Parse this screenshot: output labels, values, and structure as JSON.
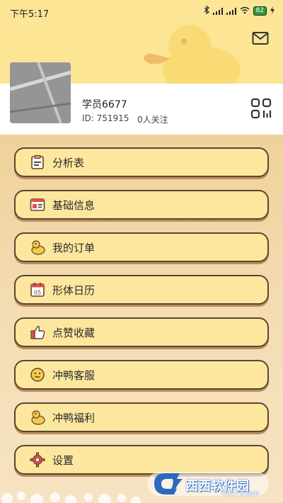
{
  "status_bar": {
    "time": "下午5:17",
    "battery": "82"
  },
  "profile": {
    "username": "学员6677",
    "user_id": "ID: 751915",
    "follow_count": "0人关注"
  },
  "menu": [
    {
      "label": "分析表",
      "icon": "clipboard-icon"
    },
    {
      "label": "基础信息",
      "icon": "id-card-icon"
    },
    {
      "label": "我的订单",
      "icon": "duck-icon"
    },
    {
      "label": "形体日历",
      "icon": "calendar-icon"
    },
    {
      "label": "点赞收藏",
      "icon": "thumbs-up-icon"
    },
    {
      "label": "冲鸭客服",
      "icon": "smiley-face-icon"
    },
    {
      "label": "冲鸭福利",
      "icon": "duck-icon"
    },
    {
      "label": "设置",
      "icon": "gear-icon"
    }
  ],
  "calendar_icon_day": "05",
  "watermark": {
    "text": "西西软件园",
    "sub": "CR173.com"
  },
  "colors": {
    "header_yellow": "#fde596",
    "button_fill": "#fde79f",
    "button_border": "#5a4630",
    "sand": "#f3d9a8"
  }
}
